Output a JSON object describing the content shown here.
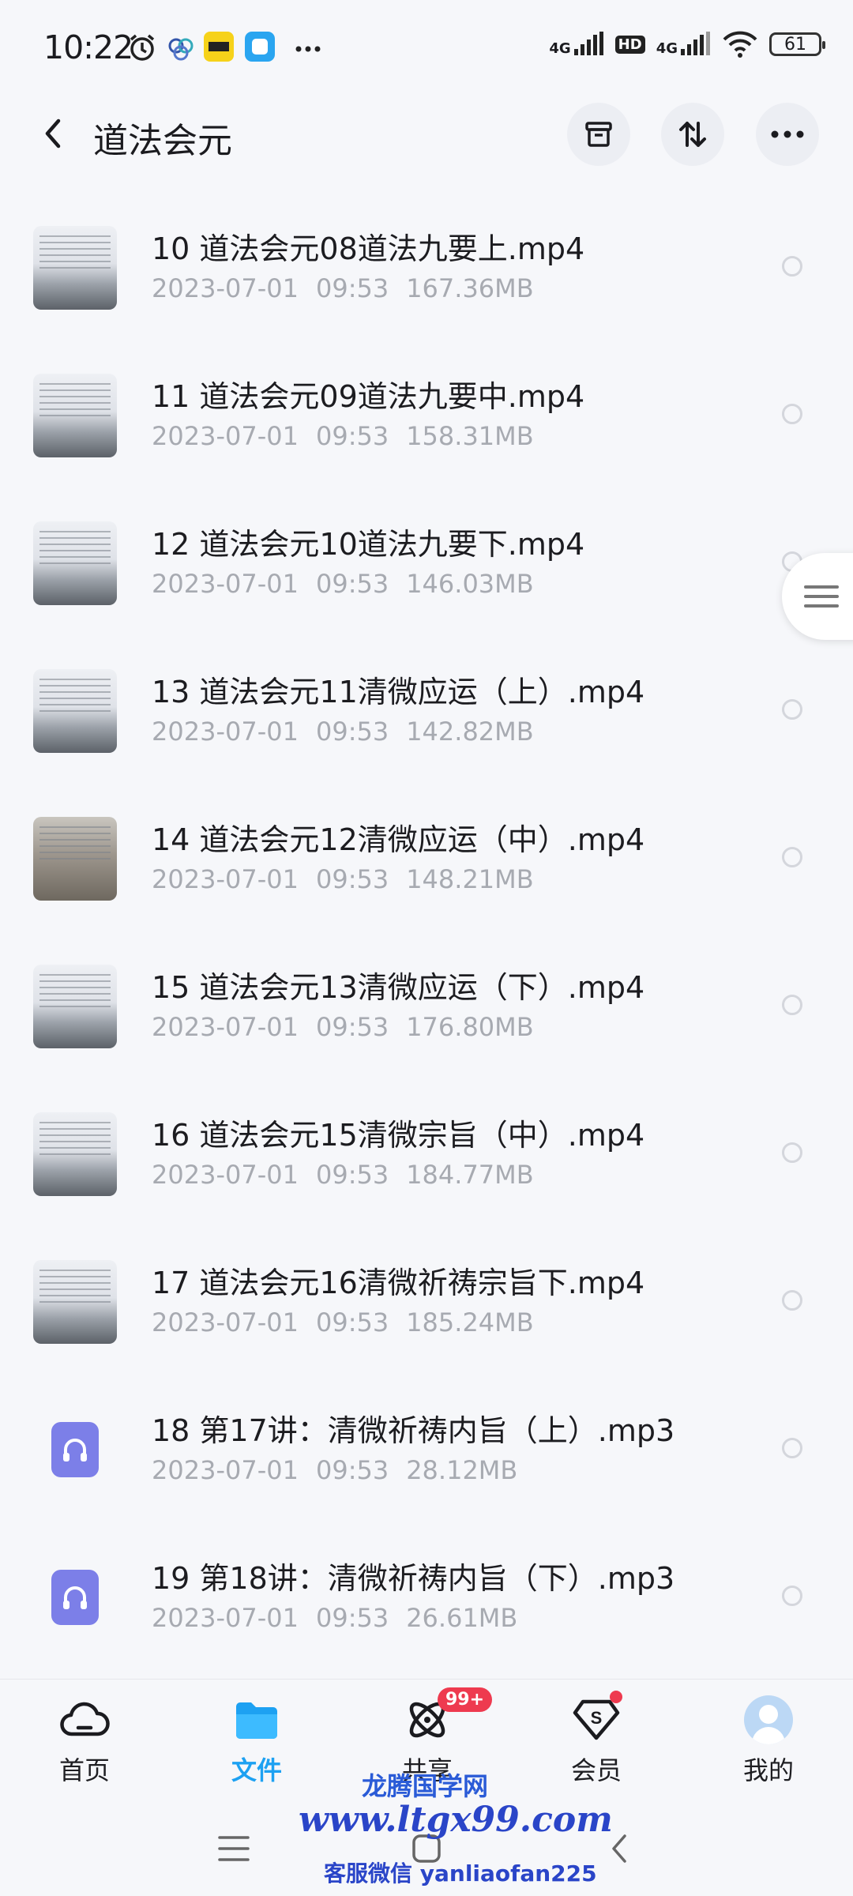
{
  "status_bar": {
    "time": "10:22",
    "network1": "4G",
    "hd": "HD",
    "network2": "4G",
    "battery": "61"
  },
  "header": {
    "title": "道法会元"
  },
  "files": [
    {
      "name": "10 道法会元08道法九要上.mp4",
      "date": "2023-07-01",
      "time": "09:53",
      "size": "167.36MB",
      "type": "video",
      "tone": "light"
    },
    {
      "name": "11 道法会元09道法九要中.mp4",
      "date": "2023-07-01",
      "time": "09:53",
      "size": "158.31MB",
      "type": "video",
      "tone": "light"
    },
    {
      "name": "12 道法会元10道法九要下.mp4",
      "date": "2023-07-01",
      "time": "09:53",
      "size": "146.03MB",
      "type": "video",
      "tone": "light"
    },
    {
      "name": "13 道法会元11清微应运（上）.mp4",
      "date": "2023-07-01",
      "time": "09:53",
      "size": "142.82MB",
      "type": "video",
      "tone": "light"
    },
    {
      "name": "14 道法会元12清微应运（中）.mp4",
      "date": "2023-07-01",
      "time": "09:53",
      "size": "148.21MB",
      "type": "video",
      "tone": "dark"
    },
    {
      "name": "15 道法会元13清微应运（下）.mp4",
      "date": "2023-07-01",
      "time": "09:53",
      "size": "176.80MB",
      "type": "video",
      "tone": "light"
    },
    {
      "name": "16 道法会元15清微宗旨（中）.mp4",
      "date": "2023-07-01",
      "time": "09:53",
      "size": "184.77MB",
      "type": "video",
      "tone": "light"
    },
    {
      "name": "17 道法会元16清微祈祷宗旨下.mp4",
      "date": "2023-07-01",
      "time": "09:53",
      "size": "185.24MB",
      "type": "video",
      "tone": "light"
    },
    {
      "name": "18 第17讲：清微祈祷内旨（上）.mp3",
      "date": "2023-07-01",
      "time": "09:53",
      "size": "28.12MB",
      "type": "audio",
      "tone": "light"
    },
    {
      "name": "19 第18讲：清微祈祷内旨（下）.mp3",
      "date": "2023-07-01",
      "time": "09:53",
      "size": "26.61MB",
      "type": "audio",
      "tone": "light"
    }
  ],
  "bottom_nav": {
    "home": "首页",
    "files": "文件",
    "share": "共享",
    "share_badge": "99+",
    "vip": "会员",
    "mine": "我的"
  },
  "watermark": {
    "line1": "龙腾国学网",
    "line2": "www.ltgx99.com",
    "line3": "客服微信 yanliaofan225"
  },
  "colors": {
    "active": "#1da1f2",
    "badge": "#ee3a4f",
    "audio_icon": "#7c7fe8",
    "watermark": "#2a45c8"
  }
}
